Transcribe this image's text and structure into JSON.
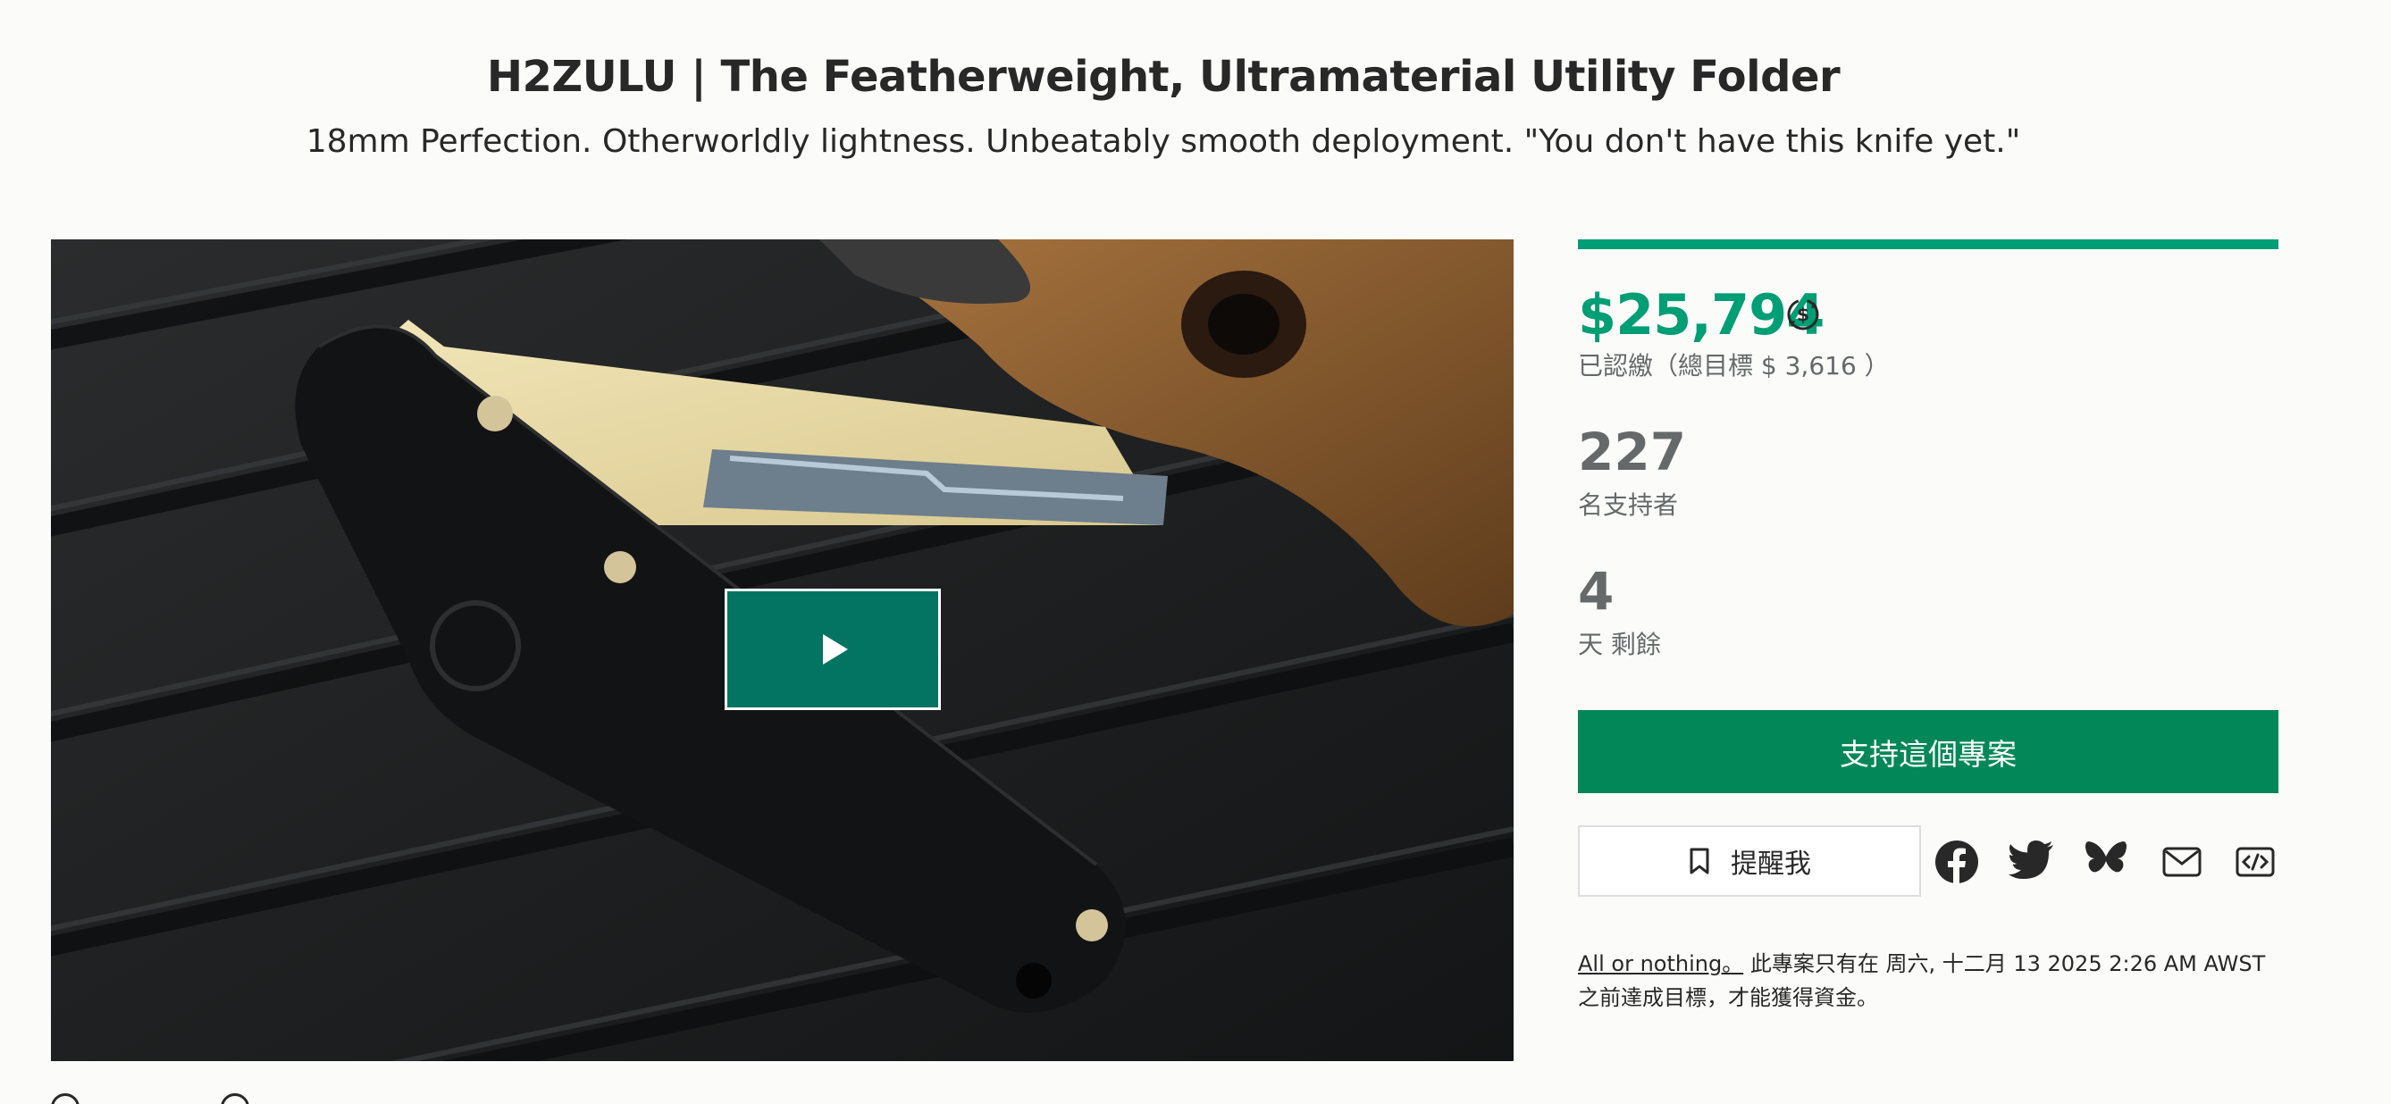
{
  "project": {
    "title": "H2ZULU | The Featherweight, Ultramaterial Utility Folder",
    "blurb": "18mm Perfection. Otherworldly lightness. Unbeatably smooth deployment. \"You don't have this knife yet.\""
  },
  "video": {
    "play_icon": "play-icon"
  },
  "stats": {
    "pledged": "$25,794",
    "pledged_label": "已認繳（總目標 $ 3,616 ）",
    "progress_percent": 100,
    "backers": "227",
    "backers_label": "名支持者",
    "days": "4",
    "days_label": "天 剩餘"
  },
  "actions": {
    "back_label": "支持這個專案",
    "remind_label": "提醒我",
    "share_icons": [
      "facebook-icon",
      "twitter-icon",
      "bluesky-icon",
      "email-icon",
      "embed-icon"
    ]
  },
  "funding_note": {
    "link": "All or nothing。",
    "text": " 此專案只有在 周六, 十二月 13 2025 2:26 AM AWST 之前達成目標，才能獲得資金。"
  },
  "colors": {
    "accent": "#009e74",
    "button": "#028858",
    "play": "#037362",
    "muted": "#656969"
  }
}
